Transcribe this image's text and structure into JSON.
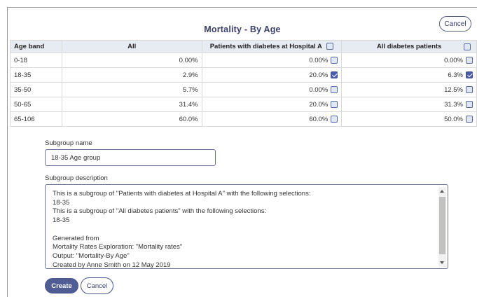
{
  "dialog": {
    "title": "Mortality - By Age",
    "cancel_top_label": "Cancel"
  },
  "table": {
    "headers": [
      "Age band",
      "All",
      "Patients with diabetes at Hospital A",
      "All diabetes patients"
    ],
    "header_checkboxes": {
      "col2_checked": false,
      "col3_checked": false
    },
    "rows": [
      {
        "age_band": "0-18",
        "all": "0.00%",
        "hospital_a": "0.00%",
        "hospital_a_checked": false,
        "all_diabetes": "0.00%",
        "all_diabetes_checked": false
      },
      {
        "age_band": "18-35",
        "all": "2.9%",
        "hospital_a": "20.0%",
        "hospital_a_checked": true,
        "all_diabetes": "6.3%",
        "all_diabetes_checked": true
      },
      {
        "age_band": "35-50",
        "all": "5.7%",
        "hospital_a": "0.00%",
        "hospital_a_checked": false,
        "all_diabetes": "12.5%",
        "all_diabetes_checked": false
      },
      {
        "age_band": "50-65",
        "all": "31.4%",
        "hospital_a": "20.0%",
        "hospital_a_checked": false,
        "all_diabetes": "31.3%",
        "all_diabetes_checked": false
      },
      {
        "age_band": "65-106",
        "all": "60.0%",
        "hospital_a": "60.0%",
        "hospital_a_checked": false,
        "all_diabetes": "50.0%",
        "all_diabetes_checked": false
      }
    ]
  },
  "form": {
    "subgroup_name_label": "Subgroup name",
    "subgroup_name_value": "18-35 Age group",
    "subgroup_description_label": "Subgroup description",
    "subgroup_description_value": "This is a subgroup of \"Patients  with diabetes at Hospital A\" with the following selections:\n18-35\nThis is a subgroup of \"All diabetes patients\" with the following selections:\n18-35\n\nGenerated from\nMortality Rates Exploration: \"Mortality rates\"\nOutput: \"Mortality-By Age\"\nCreated by Anne Smith on 12 May 2019"
  },
  "actions": {
    "create_label": "Create",
    "cancel_label": "Cancel"
  },
  "colors": {
    "accent": "#525c94",
    "header_bg": "#e7ebf2",
    "checkbox_checked": "#4a5ca8"
  }
}
